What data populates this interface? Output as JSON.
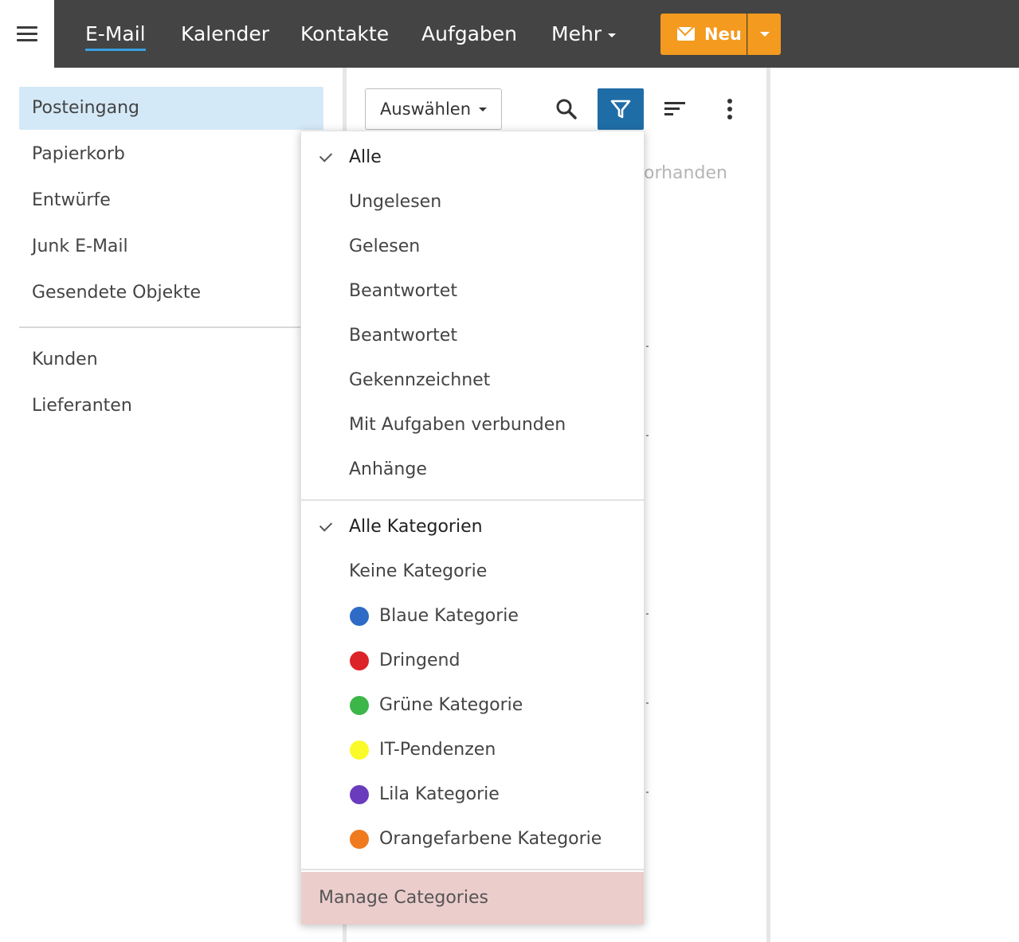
{
  "topbar": {
    "nav": [
      {
        "label": "E-Mail",
        "active": true
      },
      {
        "label": "Kalender"
      },
      {
        "label": "Kontakte"
      },
      {
        "label": "Aufgaben"
      },
      {
        "label": "Mehr"
      }
    ],
    "new_button": {
      "label": "Neu"
    }
  },
  "sidebar": {
    "folders": [
      "Posteingang",
      "Papierkorb",
      "Entwürfe",
      "Junk E-Mail",
      "Gesendete Objekte"
    ],
    "custom_folders": [
      "Kunden",
      "Lieferanten"
    ],
    "active": "Posteingang"
  },
  "list": {
    "select_label": "Auswählen",
    "empty_text_fragment": "orhanden"
  },
  "filter_menu": {
    "read_filters": [
      "Alle",
      "Ungelesen",
      "Gelesen",
      "Beantwortet",
      "Beantwortet",
      "Gekennzeichnet",
      "Mit Aufgaben verbunden",
      "Anhänge"
    ],
    "read_selected": "Alle",
    "category_filters": [
      "Alle Kategorien",
      "Keine Kategorie"
    ],
    "category_selected": "Alle Kategorien",
    "categories": [
      {
        "label": "Blaue Kategorie",
        "color": "#2e6bc6"
      },
      {
        "label": "Dringend",
        "color": "#dc2328"
      },
      {
        "label": "Grüne Kategorie",
        "color": "#3cb649"
      },
      {
        "label": "IT-Pendenzen",
        "color": "#fafa28"
      },
      {
        "label": "Lila Kategorie",
        "color": "#6a3bbd"
      },
      {
        "label": "Orangefarbene Kategorie",
        "color": "#f07a1e"
      }
    ],
    "manage_label": "Manage Categories"
  }
}
